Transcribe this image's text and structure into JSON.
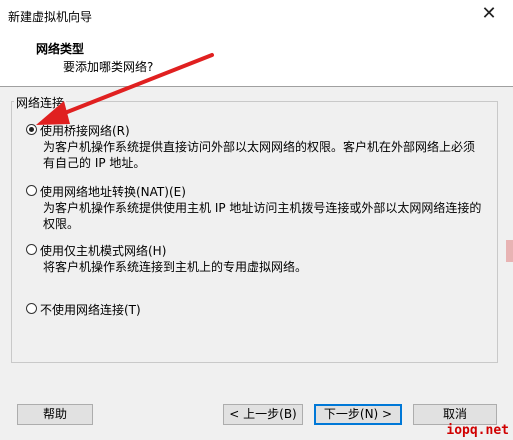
{
  "window": {
    "title": "新建虚拟机向导",
    "close_glyph": "✕"
  },
  "header": {
    "heading": "网络类型",
    "subheading": "要添加哪类网络?"
  },
  "group": {
    "legend": "网络连接"
  },
  "options": [
    {
      "label": "使用桥接网络(R)",
      "selected": true,
      "desc": [
        "为客户机操作系统提供直接访问外部以太网网络的权限。客户机在外部网络上必须",
        "有自己的 IP 地址。"
      ]
    },
    {
      "label": "使用网络地址转换(NAT)(E)",
      "selected": false,
      "desc": [
        "为客户机操作系统提供使用主机 IP 地址访问主机拨号连接或外部以太网网络连接的",
        "权限。"
      ]
    },
    {
      "label": "使用仅主机模式网络(H)",
      "selected": false,
      "desc": [
        "将客户机操作系统连接到主机上的专用虚拟网络。"
      ]
    },
    {
      "label": "不使用网络连接(T)",
      "selected": false,
      "desc": []
    }
  ],
  "buttons": {
    "help": "帮助",
    "back": "< 上一步(B)",
    "next": "下一步(N) >",
    "cancel": "取消"
  },
  "annotation": {
    "arrow_color": "#e02020"
  },
  "watermark": "iopq.net"
}
